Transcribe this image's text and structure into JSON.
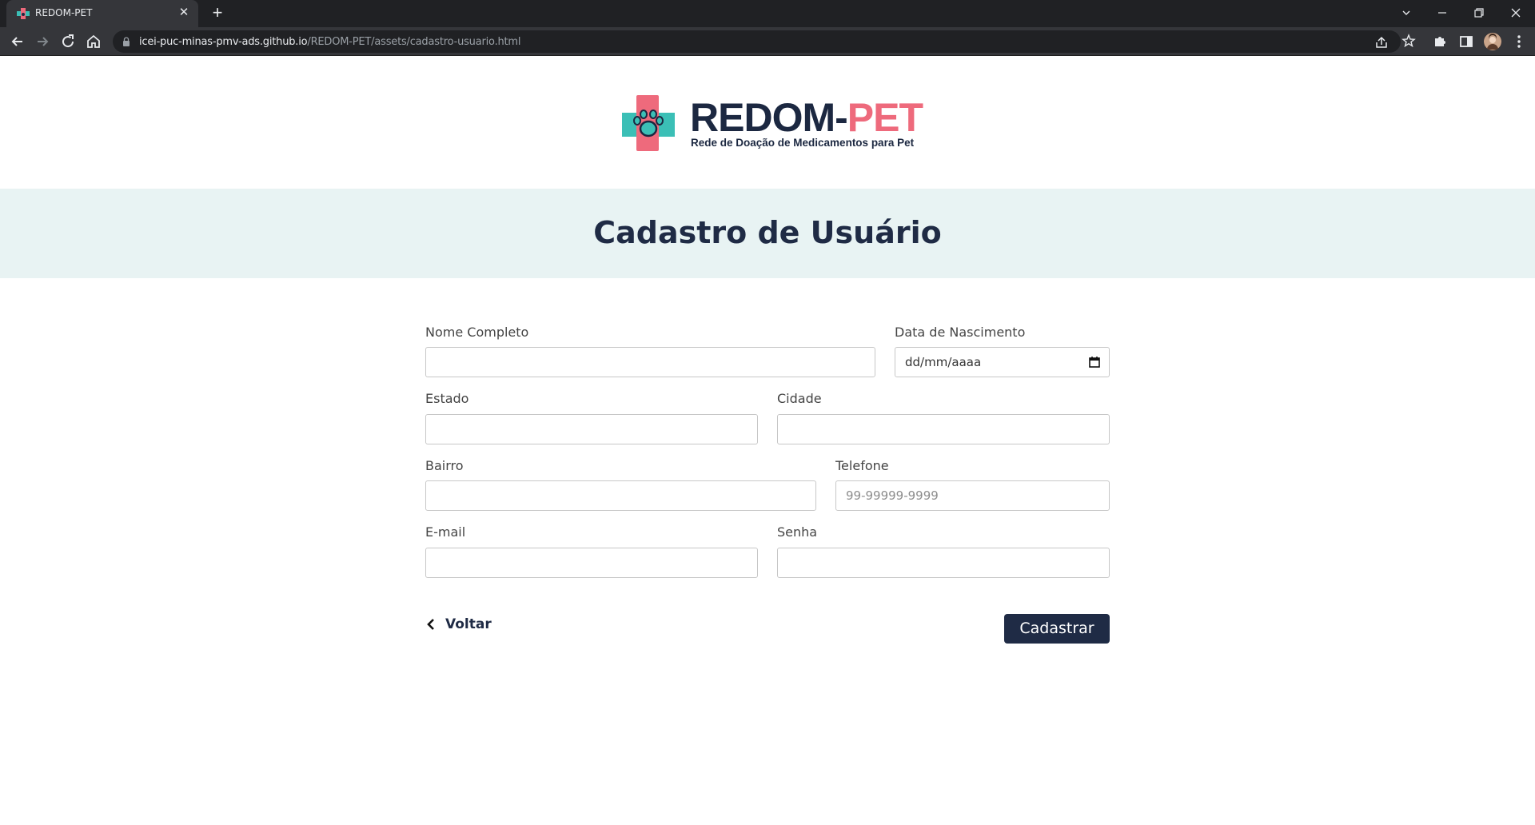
{
  "browser": {
    "tab_title": "REDOM-PET",
    "url_host": "icei-puc-minas-pmv-ads.github.io",
    "url_path": "/REDOM-PET/assets/cadastro-usuario.html"
  },
  "logo": {
    "title_part1": "REDOM-",
    "title_part2": "PET",
    "subtitle": "Rede de Doação de Medicamentos para Pet"
  },
  "banner": {
    "title": "Cadastro de Usuário"
  },
  "form": {
    "nome": {
      "label": "Nome Completo",
      "value": ""
    },
    "nascimento": {
      "label": "Data de Nascimento",
      "value": "dd/mm/aaaa"
    },
    "estado": {
      "label": "Estado",
      "value": ""
    },
    "cidade": {
      "label": "Cidade",
      "value": ""
    },
    "bairro": {
      "label": "Bairro",
      "value": ""
    },
    "telefone": {
      "label": "Telefone",
      "placeholder": "99-99999-9999"
    },
    "email": {
      "label": "E-mail",
      "value": ""
    },
    "senha": {
      "label": "Senha",
      "value": ""
    }
  },
  "actions": {
    "back_label": "Voltar",
    "submit_label": "Cadastrar"
  },
  "colors": {
    "navy": "#1f2b45",
    "pink": "#ee6a7c",
    "teal": "#3bbfb6",
    "banner_bg": "#e8f3f3"
  }
}
